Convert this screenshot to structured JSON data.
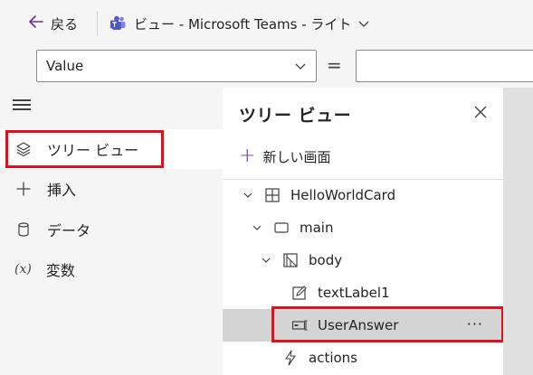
{
  "header": {
    "back_label": "戻る",
    "view_title": "ビュー - Microsoft Teams - ライト"
  },
  "formula_bar": {
    "property_value": "Value",
    "equals": "=",
    "formula_value": ""
  },
  "nav": {
    "items": [
      {
        "label": "ツリー ビュー",
        "icon": "layers-icon",
        "selected": true
      },
      {
        "label": "挿入",
        "icon": "plus-icon"
      },
      {
        "label": "データ",
        "icon": "database-icon"
      },
      {
        "label": "変数",
        "icon": "variable-icon",
        "icon_text": "(x)"
      }
    ]
  },
  "tree_panel": {
    "title": "ツリー ビュー",
    "new_screen_label": "新しい画面",
    "nodes": [
      {
        "label": "HelloWorldCard",
        "icon": "card-icon",
        "expanded": true
      },
      {
        "label": "main",
        "icon": "container-icon",
        "expanded": true
      },
      {
        "label": "body",
        "icon": "body-icon",
        "expanded": true
      },
      {
        "label": "textLabel1",
        "icon": "edit-text-icon"
      },
      {
        "label": "UserAnswer",
        "icon": "input-icon",
        "selected": true,
        "more": "···"
      },
      {
        "label": "actions",
        "icon": "lightning-icon"
      }
    ]
  },
  "colors": {
    "highlight": "#e0101e",
    "accent": "#6b2fa2"
  }
}
